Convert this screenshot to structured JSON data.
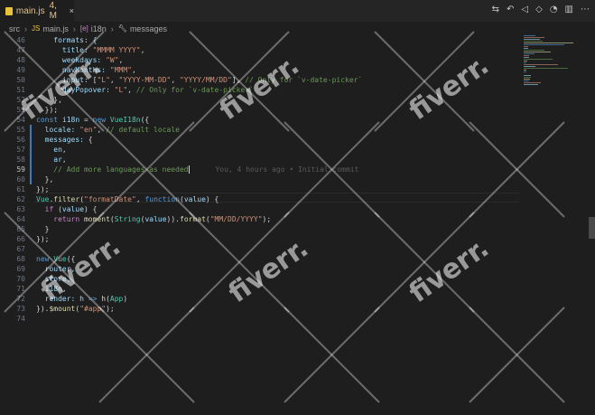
{
  "tab": {
    "icon": "javascript-file-icon",
    "filename": "main.js",
    "meta": "4, M",
    "close": "×"
  },
  "toolbar": {
    "icons": [
      "compare-changes-icon",
      "git-history-icon",
      "go-back-icon",
      "go-forward-icon",
      "toggle-blame-icon",
      "split-editor-icon",
      "more-actions-icon"
    ]
  },
  "breadcrumb": {
    "folder": "src",
    "file": "main.js",
    "symbol": "i18n",
    "property": "messages",
    "sep": "›"
  },
  "editor": {
    "active_line": 59,
    "blame": "You, 4 hours ago • Initial commit",
    "lines": [
      {
        "n": "46",
        "tokens": [
          [
            "    formats: {",
            "p"
          ]
        ]
      },
      {
        "n": "47",
        "tokens": [
          [
            "      title: ",
            "p"
          ],
          [
            "\"MMMM YYYY\"",
            "s"
          ],
          [
            ",",
            ""
          ]
        ]
      },
      {
        "n": "48",
        "tokens": [
          [
            "      weekdays: ",
            "p"
          ],
          [
            "\"W\"",
            "s"
          ],
          [
            ",",
            ""
          ]
        ]
      },
      {
        "n": "49",
        "tokens": [
          [
            "      navMonths: ",
            "p"
          ],
          [
            "\"MMM\"",
            "s"
          ],
          [
            ",",
            ""
          ]
        ]
      },
      {
        "n": "50",
        "tokens": [
          [
            "      input: ",
            "p"
          ],
          [
            "[",
            ""
          ],
          [
            "\"L\"",
            "s"
          ],
          [
            ", ",
            ""
          ],
          [
            "\"YYYY-MM-DD\"",
            "s"
          ],
          [
            ", ",
            ""
          ],
          [
            "\"YYYY/MM/DD\"",
            "s"
          ],
          [
            "], ",
            ""
          ],
          [
            "// Only for `v-date-picker`",
            "c"
          ]
        ]
      },
      {
        "n": "51",
        "tokens": [
          [
            "      dayPopover: ",
            "p"
          ],
          [
            "\"L\"",
            "s"
          ],
          [
            ", ",
            ""
          ],
          [
            "// Only for `v-date-picker`",
            "c"
          ]
        ]
      },
      {
        "n": "52",
        "tokens": [
          [
            "    },",
            ""
          ]
        ]
      },
      {
        "n": "53",
        "tokens": [
          [
            "  });",
            ""
          ]
        ]
      },
      {
        "n": "54",
        "tokens": [
          [
            "const ",
            "k"
          ],
          [
            "i18n",
            "p"
          ],
          [
            " = ",
            ""
          ],
          [
            "new ",
            "k"
          ],
          [
            "VueI18n",
            "cls"
          ],
          [
            "({",
            ""
          ]
        ]
      },
      {
        "n": "55",
        "tokens": [
          [
            "  locale: ",
            "p"
          ],
          [
            "\"en\"",
            "s"
          ],
          [
            ", ",
            ""
          ],
          [
            "// default locale",
            "c"
          ]
        ]
      },
      {
        "n": "56",
        "tokens": [
          [
            "  messages: ",
            "p"
          ],
          [
            "{",
            ""
          ]
        ]
      },
      {
        "n": "57",
        "tokens": [
          [
            "    en,",
            "p"
          ]
        ]
      },
      {
        "n": "58",
        "tokens": [
          [
            "    ar,",
            "p"
          ]
        ]
      },
      {
        "n": "59",
        "tokens": [
          [
            "    // Add more languages as needed",
            "c"
          ]
        ]
      },
      {
        "n": "60",
        "tokens": [
          [
            "  },",
            ""
          ]
        ]
      },
      {
        "n": "61",
        "tokens": [
          [
            "});",
            ""
          ]
        ]
      },
      {
        "n": "62",
        "tokens": [
          [
            "Vue",
            "cls"
          ],
          [
            ".",
            ""
          ],
          [
            "filter",
            "f"
          ],
          [
            "(",
            ""
          ],
          [
            "\"formatDate\"",
            "s"
          ],
          [
            ", ",
            ""
          ],
          [
            "function",
            "k"
          ],
          [
            "(",
            ""
          ],
          [
            "value",
            "p"
          ],
          [
            ") {",
            ""
          ]
        ]
      },
      {
        "n": "63",
        "tokens": [
          [
            "  if ",
            "ctl"
          ],
          [
            "(",
            ""
          ],
          [
            "value",
            "p"
          ],
          [
            ") {",
            ""
          ]
        ]
      },
      {
        "n": "64",
        "tokens": [
          [
            "    return ",
            "ctl"
          ],
          [
            "moment",
            "f"
          ],
          [
            "(",
            ""
          ],
          [
            "String",
            "cls"
          ],
          [
            "(",
            ""
          ],
          [
            "value",
            "p"
          ],
          [
            ")).",
            ""
          ],
          [
            "format",
            "f"
          ],
          [
            "(",
            ""
          ],
          [
            "\"MM/DD/YYYY\"",
            "s"
          ],
          [
            ");",
            ""
          ]
        ]
      },
      {
        "n": "65",
        "tokens": [
          [
            "  }",
            ""
          ]
        ]
      },
      {
        "n": "66",
        "tokens": [
          [
            "});",
            ""
          ]
        ]
      },
      {
        "n": "67",
        "tokens": [
          [
            "",
            ""
          ]
        ]
      },
      {
        "n": "68",
        "tokens": [
          [
            "new ",
            "k"
          ],
          [
            "Vue",
            "cls"
          ],
          [
            "({",
            ""
          ]
        ]
      },
      {
        "n": "69",
        "tokens": [
          [
            "  router,",
            "p"
          ]
        ]
      },
      {
        "n": "70",
        "tokens": [
          [
            "  store,",
            "p"
          ]
        ]
      },
      {
        "n": "71",
        "tokens": [
          [
            "  i18n,",
            "p"
          ]
        ]
      },
      {
        "n": "72",
        "tokens": [
          [
            "  render: ",
            "p"
          ],
          [
            "h",
            "p"
          ],
          [
            " => ",
            "k"
          ],
          [
            "h",
            "f"
          ],
          [
            "(",
            ""
          ],
          [
            "App",
            "cls"
          ],
          [
            ")",
            ""
          ]
        ]
      },
      {
        "n": "73",
        "tokens": [
          [
            "}).",
            ""
          ],
          [
            "$mount",
            "f"
          ],
          [
            "(",
            ""
          ],
          [
            "\"#app\"",
            "s"
          ],
          [
            ");",
            ""
          ]
        ]
      },
      {
        "n": "74",
        "tokens": [
          [
            "",
            ""
          ]
        ]
      }
    ]
  },
  "watermark": "fiverr.",
  "colors": {
    "background": "#1e1e1e",
    "tab_text": "#e2c08d",
    "keyword": "#569cd6",
    "string": "#ce9178",
    "comment": "#6a9955"
  }
}
